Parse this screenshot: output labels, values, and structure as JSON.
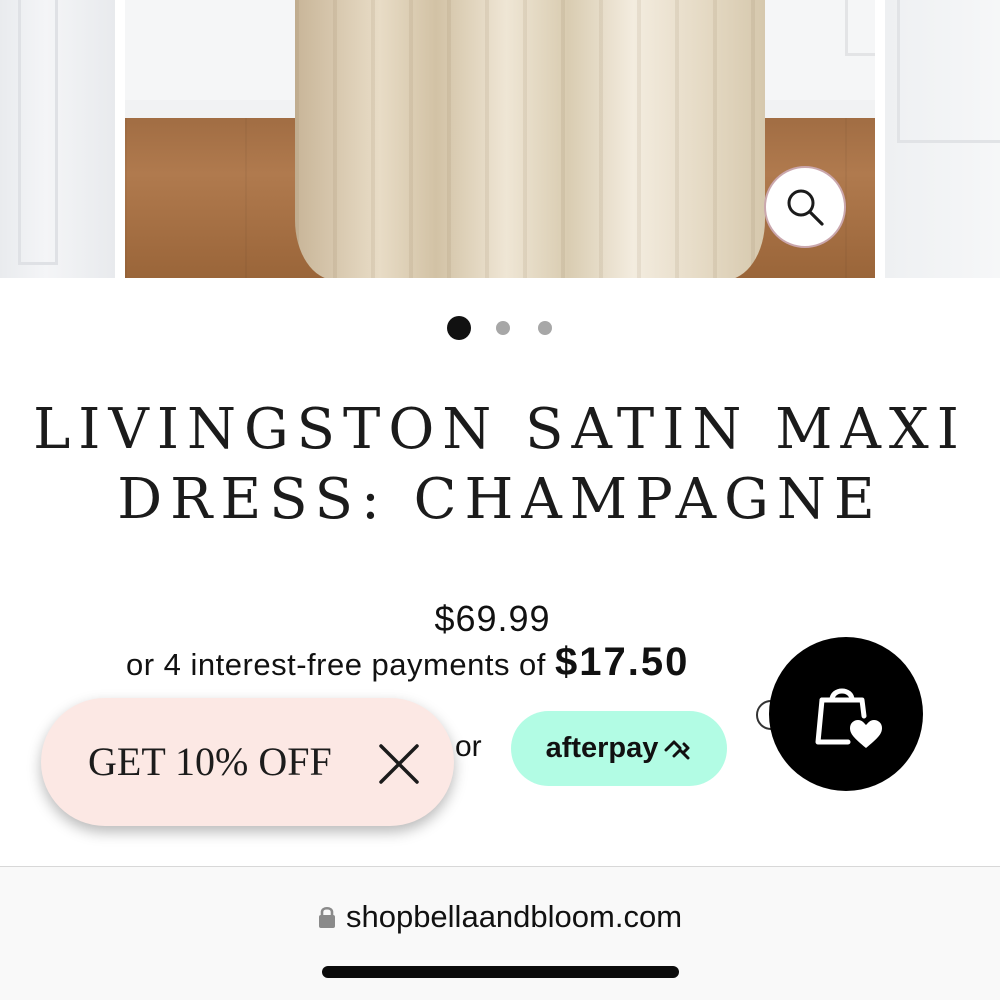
{
  "product": {
    "title": "LIVINGSTON SATIN MAXI DRESS: CHAMPAGNE",
    "price": "$69.99",
    "installments_prefix": "or 4 interest-free payments of ",
    "installment_amount": "$17.50",
    "or_label": "or",
    "afterpay_label": "afterpay"
  },
  "gallery": {
    "zoom_icon": "search-icon",
    "total_slides": 3,
    "active_slide": 1
  },
  "popup": {
    "discount_label": "GET 10% OFF",
    "close_icon": "close-icon"
  },
  "cart": {
    "icon": "shopping-bag-heart-icon"
  },
  "browser": {
    "url": "shopbellaandbloom.com",
    "lock_icon": "lock-icon"
  },
  "colors": {
    "afterpay_mint": "#b2fce4",
    "popup_pink": "#fce8e4",
    "cart_black": "#000000"
  }
}
